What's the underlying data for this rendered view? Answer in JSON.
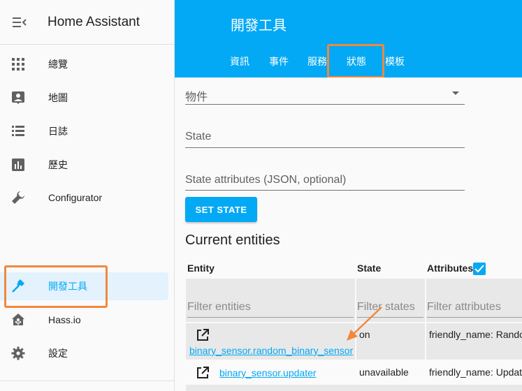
{
  "app": {
    "title": "Home Assistant"
  },
  "sidebar": {
    "items": [
      {
        "label": "總覽",
        "icon": "grid-icon"
      },
      {
        "label": "地圖",
        "icon": "account-box-icon"
      },
      {
        "label": "日誌",
        "icon": "list-icon"
      },
      {
        "label": "歷史",
        "icon": "chart-icon"
      },
      {
        "label": "Configurator",
        "icon": "wrench-icon"
      },
      {
        "label": "開發工具",
        "icon": "hammer-icon",
        "active": true
      },
      {
        "label": "Hass.io",
        "icon": "home-assistant-icon"
      },
      {
        "label": "設定",
        "icon": "gear-icon"
      }
    ]
  },
  "header": {
    "title": "開發工具",
    "tabs": [
      {
        "label": "資訊"
      },
      {
        "label": "事件"
      },
      {
        "label": "服務"
      },
      {
        "label": "狀態",
        "active": true
      },
      {
        "label": "模板"
      }
    ]
  },
  "form": {
    "entity_label": "物件",
    "state_label": "State",
    "attributes_label": "State attributes (JSON, optional)",
    "set_state_button": "SET STATE"
  },
  "entities": {
    "section_title": "Current entities",
    "columns": {
      "entity": "Entity",
      "state": "State",
      "attributes": "Attributes"
    },
    "attributes_checked": true,
    "filters": {
      "entity": "Filter entities",
      "state": "Filter states",
      "attributes": "Filter attributes"
    },
    "rows": [
      {
        "entity": "binary_sensor.random_binary_sensor",
        "state": "on",
        "attributes": "friendly_name: Rando"
      },
      {
        "entity": "binary_sensor.updater",
        "state": "unavailable",
        "attributes": "friendly_name: Update"
      }
    ]
  },
  "colors": {
    "accent": "#03a9f4",
    "highlight": "#f0883e",
    "sidebar_active_bg": "#e3f2fd"
  }
}
